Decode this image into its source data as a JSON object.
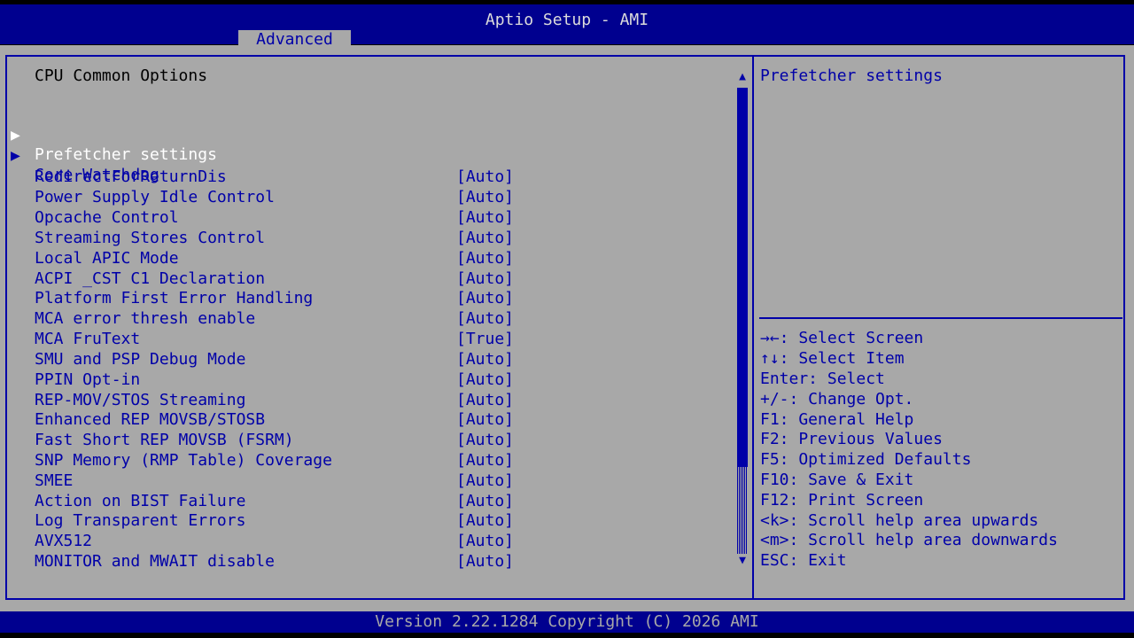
{
  "header": {
    "title": "Aptio Setup - AMI",
    "active_tab": "Advanced"
  },
  "main": {
    "section_title": "CPU Common Options",
    "submenus": [
      {
        "label": "Prefetcher settings",
        "selected": true
      },
      {
        "label": "Core Watchdog",
        "selected": false
      }
    ],
    "options": [
      {
        "label": "RedirectForReturnDis",
        "value": "[Auto]"
      },
      {
        "label": "Power Supply Idle Control",
        "value": "[Auto]"
      },
      {
        "label": "Opcache Control",
        "value": "[Auto]"
      },
      {
        "label": "Streaming Stores Control",
        "value": "[Auto]"
      },
      {
        "label": "Local APIC Mode",
        "value": "[Auto]"
      },
      {
        "label": "ACPI _CST C1 Declaration",
        "value": "[Auto]"
      },
      {
        "label": "Platform First Error Handling",
        "value": "[Auto]"
      },
      {
        "label": "MCA error thresh enable",
        "value": "[Auto]"
      },
      {
        "label": "MCA FruText",
        "value": "[True]"
      },
      {
        "label": "SMU and PSP Debug Mode",
        "value": "[Auto]"
      },
      {
        "label": "PPIN Opt-in",
        "value": "[Auto]"
      },
      {
        "label": "REP-MOV/STOS Streaming",
        "value": "[Auto]"
      },
      {
        "label": "Enhanced REP MOVSB/STOSB",
        "value": "[Auto]"
      },
      {
        "label": "Fast Short REP MOVSB (FSRM)",
        "value": "[Auto]"
      },
      {
        "label": "SNP Memory (RMP Table) Coverage",
        "value": "[Auto]"
      },
      {
        "label": "SMEE",
        "value": "[Auto]"
      },
      {
        "label": "Action on BIST Failure",
        "value": "[Auto]"
      },
      {
        "label": "Log Transparent Errors",
        "value": "[Auto]"
      },
      {
        "label": "AVX512",
        "value": "[Auto]"
      },
      {
        "label": "MONITOR and MWAIT disable",
        "value": "[Auto]"
      }
    ]
  },
  "help": {
    "title": "Prefetcher settings",
    "keys": [
      "→←: Select Screen",
      "↑↓: Select Item",
      "Enter: Select",
      "+/-: Change Opt.",
      "F1: General Help",
      "F2: Previous Values",
      "F5: Optimized Defaults",
      "F10: Save & Exit",
      "F12: Print Screen",
      "<k>: Scroll help area upwards",
      "<m>: Scroll help area downwards",
      "ESC: Exit"
    ]
  },
  "footer": {
    "text": "Version 2.22.1284 Copyright (C) 2026 AMI"
  },
  "icons": {
    "submenu_pointer": "▶",
    "scroll_up": "▲",
    "scroll_down": "▼"
  },
  "colors": {
    "header_bg": "#00008f",
    "panel_bg": "#a8a8a8",
    "text_blue": "#0000a8",
    "text_white": "#ffffff"
  }
}
